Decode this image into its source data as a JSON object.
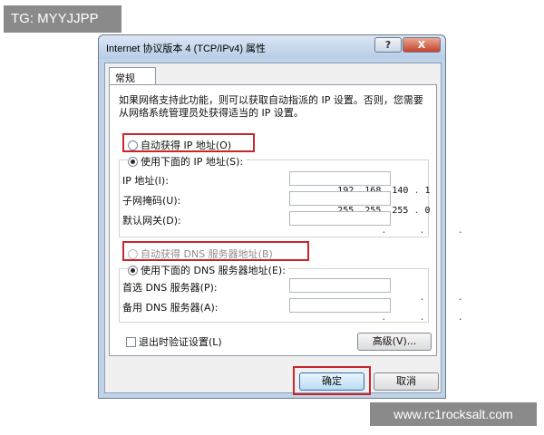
{
  "watermark": {
    "top_left": "TG: MYYJJPP",
    "bottom_right": "www.rc1rocksalt.com"
  },
  "window": {
    "title": "Internet 协议版本 4 (TCP/IPv4) 属性",
    "help_label": "?",
    "close_label": "X"
  },
  "tab": {
    "label": "常规"
  },
  "description": "如果网络支持此功能，则可以获取自动指派的 IP 设置。否则，您需要从网络系统管理员处获得适当的 IP 设置。",
  "ip_section": {
    "auto_label": "自动获得 IP 地址(O)",
    "manual_label": "使用下面的 IP 地址(S):",
    "selected": "manual",
    "fields": [
      {
        "label": "IP 地址(I):",
        "octets": [
          "192",
          "168",
          "140",
          "1"
        ]
      },
      {
        "label": "子网掩码(U):",
        "octets": [
          "255",
          "255",
          "255",
          "0"
        ]
      },
      {
        "label": "默认网关(D):",
        "octets": [
          "",
          "",
          "",
          ""
        ]
      }
    ]
  },
  "dns_section": {
    "auto_label": "自动获得 DNS 服务器地址(B)",
    "manual_label": "使用下面的 DNS 服务器地址(E):",
    "selected": "manual",
    "fields": [
      {
        "label": "首选 DNS 服务器(P):",
        "octets": [
          "",
          "",
          "",
          ""
        ]
      },
      {
        "label": "备用 DNS 服务器(A):",
        "octets": [
          "",
          "",
          "",
          ""
        ]
      }
    ]
  },
  "validate_checkbox": {
    "label": "退出时验证设置(L)",
    "checked": false
  },
  "advanced_button": "高级(V)...",
  "ok_button": "确定",
  "cancel_button": "取消",
  "colors": {
    "highlight_border": "#c8262b",
    "default_button_border": "#2f6fb5"
  }
}
